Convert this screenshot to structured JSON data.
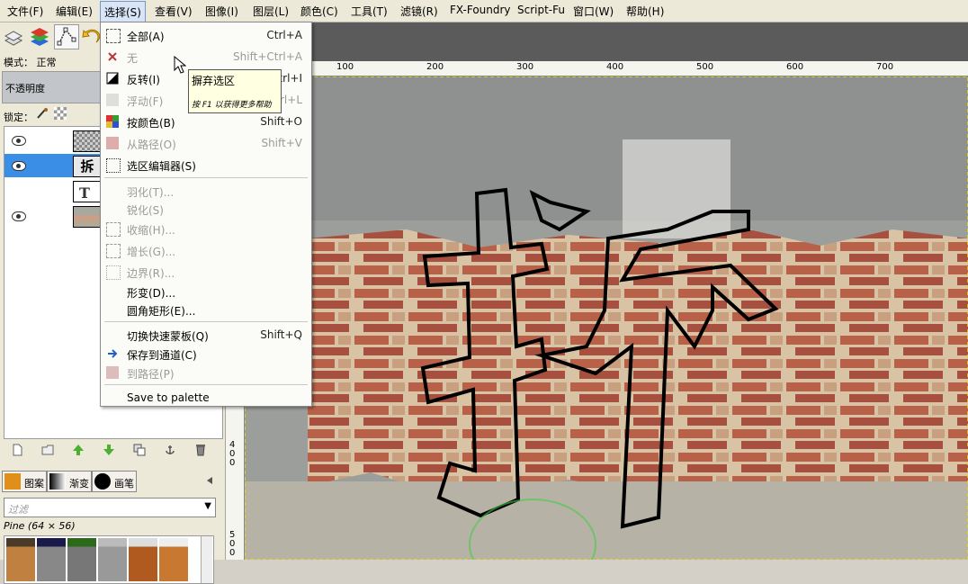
{
  "menubar": {
    "items": [
      "文件(F)",
      "编辑(E)",
      "选择(S)",
      "查看(V)",
      "图像(I)",
      "图层(L)",
      "颜色(C)",
      "工具(T)",
      "滤镜(R)",
      "FX-Foundry",
      "Script-Fu",
      "窗口(W)",
      "帮助(H)"
    ]
  },
  "layers_panel": {
    "mode_label": "模式：",
    "mode_value": "正常",
    "opacity_label": "不透明度",
    "lock_label": "锁定："
  },
  "brushes_panel": {
    "tabs": [
      "图案",
      "渐变",
      "画笔"
    ],
    "filter_placeholder": "过滤",
    "pattern_info": "Pine (64 × 56)"
  },
  "ruler": {
    "top_ticks": [
      "100",
      "200",
      "300",
      "400",
      "500",
      "600",
      "700"
    ],
    "left_ticks": [
      "4\n0\n0",
      "5\n0\n0"
    ]
  },
  "select_menu": {
    "items": [
      {
        "label": "全部(A)",
        "shortcut": "Ctrl+A",
        "enabled": true,
        "icon": "select-all-icon"
      },
      {
        "label": "无",
        "shortcut": "Shift+Ctrl+A",
        "enabled": false,
        "icon": "select-none-icon"
      },
      {
        "label": "反转(I)",
        "shortcut": "Ctrl+I",
        "enabled": true,
        "icon": "invert-icon"
      },
      {
        "label": "浮动(F)",
        "shortcut": "Shift+Ctrl+L",
        "enabled": false,
        "icon": "float-icon"
      },
      {
        "label": "按颜色(B)",
        "shortcut": "Shift+O",
        "enabled": true,
        "icon": "by-color-icon"
      },
      {
        "label": "从路径(O)",
        "shortcut": "Shift+V",
        "enabled": false,
        "icon": "from-path-icon"
      },
      {
        "label": "选区编辑器(S)",
        "shortcut": "",
        "enabled": true,
        "icon": "selection-editor-icon"
      },
      {
        "label": "羽化(T)...",
        "shortcut": "",
        "enabled": false,
        "icon": ""
      },
      {
        "label": "锐化(S)",
        "shortcut": "",
        "enabled": false,
        "icon": ""
      },
      {
        "label": "收缩(H)...",
        "shortcut": "",
        "enabled": false,
        "icon": "shrink-icon"
      },
      {
        "label": "增长(G)...",
        "shortcut": "",
        "enabled": false,
        "icon": "grow-icon"
      },
      {
        "label": "边界(R)...",
        "shortcut": "",
        "enabled": false,
        "icon": "border-icon"
      },
      {
        "label": "形变(D)...",
        "shortcut": "",
        "enabled": true,
        "icon": ""
      },
      {
        "label": "圆角矩形(E)...",
        "shortcut": "",
        "enabled": true,
        "icon": ""
      },
      {
        "label": "切换快速蒙板(Q)",
        "shortcut": "Shift+Q",
        "enabled": true,
        "icon": ""
      },
      {
        "label": "保存到通道(C)",
        "shortcut": "",
        "enabled": true,
        "icon": "save-channel-icon"
      },
      {
        "label": "到路径(P)",
        "shortcut": "",
        "enabled": false,
        "icon": "to-path-icon"
      },
      {
        "label": "Save to palette",
        "shortcut": "",
        "enabled": true,
        "icon": ""
      }
    ]
  },
  "tooltip": {
    "title": "摒弃选区",
    "hint": "按 F1 以获得更多帮助"
  },
  "canvas": {
    "glyph": "拆"
  }
}
